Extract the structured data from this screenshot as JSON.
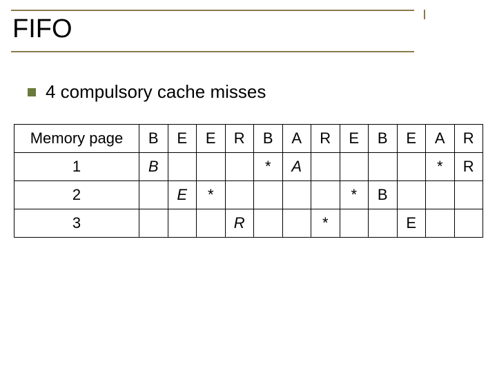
{
  "title": "FIFO",
  "bullet": "4 compulsory cache misses",
  "table": {
    "row_header_label": "Memory page",
    "columns": [
      "B",
      "E",
      "E",
      "R",
      "B",
      "A",
      "R",
      "E",
      "B",
      "E",
      "A",
      "R"
    ],
    "rows": [
      {
        "label": "1",
        "cells": [
          {
            "t": "B",
            "i": true
          },
          {
            "t": ""
          },
          {
            "t": ""
          },
          {
            "t": ""
          },
          {
            "t": "*"
          },
          {
            "t": "A",
            "i": true
          },
          {
            "t": ""
          },
          {
            "t": ""
          },
          {
            "t": ""
          },
          {
            "t": ""
          },
          {
            "t": "*"
          },
          {
            "t": "R"
          }
        ]
      },
      {
        "label": "2",
        "cells": [
          {
            "t": ""
          },
          {
            "t": "E",
            "i": true
          },
          {
            "t": "*"
          },
          {
            "t": ""
          },
          {
            "t": ""
          },
          {
            "t": ""
          },
          {
            "t": ""
          },
          {
            "t": "*"
          },
          {
            "t": "B"
          },
          {
            "t": ""
          },
          {
            "t": ""
          },
          {
            "t": ""
          }
        ]
      },
      {
        "label": "3",
        "cells": [
          {
            "t": ""
          },
          {
            "t": ""
          },
          {
            "t": ""
          },
          {
            "t": "R",
            "i": true
          },
          {
            "t": ""
          },
          {
            "t": ""
          },
          {
            "t": "*"
          },
          {
            "t": ""
          },
          {
            "t": ""
          },
          {
            "t": "E"
          },
          {
            "t": ""
          },
          {
            "t": ""
          }
        ]
      }
    ]
  }
}
